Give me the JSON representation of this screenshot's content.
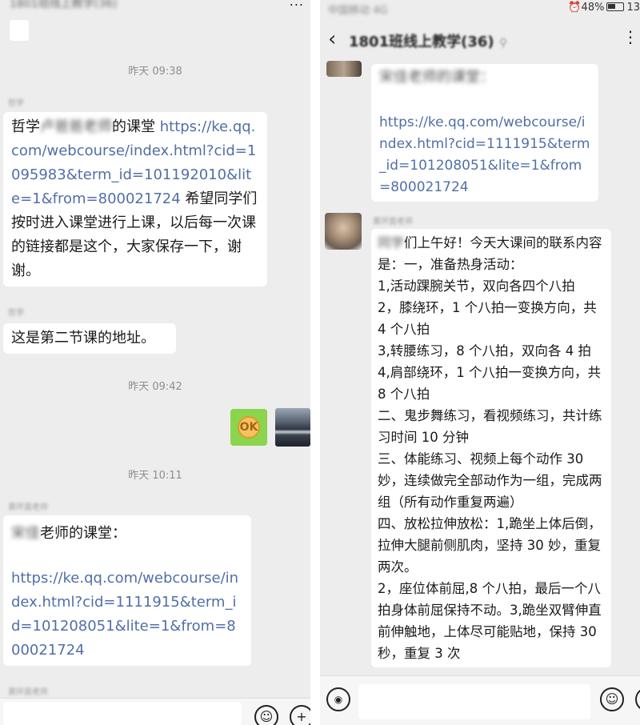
{
  "left": {
    "top_title": "1801班线上教学(36)",
    "top_dots": "...",
    "ts1": "昨天 09:38",
    "sender1": "哲学",
    "msg1_prefix": "哲学",
    "msg1_blur": "卢爸爸老师",
    "msg1_text": "的课堂 ",
    "msg1_link": "https://ke.qq.com/webcourse/index.html?cid=1095983&term_id=101192010&lite=1&from=800021724",
    "msg1_tail": " 希望同学们按时进入课堂进行上课，以后每一次课的链接都是这个，大家保存一下，谢谢。",
    "sender2": "哲学",
    "msg2": "这是第二节课的地址。",
    "ts2": "昨天 09:42",
    "ok_emoji": "OK",
    "ts3": "昨天 10:11",
    "sender3": "黄环茵老师",
    "msg3_blur": "宋佳",
    "msg3_text": "老师的课堂：",
    "msg3_link": "https://ke.qq.com/webcourse/index.html?cid=1111915&term_id=101208051&lite=1&from=800021724",
    "sender4": "黄环茵老师",
    "emoji_icon": "☺",
    "plus_icon": "+"
  },
  "right": {
    "status_left": "中国移动 4G",
    "alarm_icon": "⏰",
    "battery_pct": "48%",
    "time": "13",
    "back_arrow": "‹",
    "chat_title": "1801班线上教学(36)",
    "chat_title_suffix": "⚲",
    "more_icon": "⋮",
    "msg1_blur": "宋佳",
    "msg1_text": "老师的课堂：",
    "msg1_link": "https://ke.qq.com/webcourse/index.html?cid=1111915&term_id=101208051&lite=1&from=800021724",
    "sender2": "黄环茵老师",
    "msg2_blur": "同学",
    "msg2_lines": [
      "们上午好！今天大课间的联系内容是：一，准备热身活动：",
      "1,活动踝腕关节，双向各四个八拍",
      "2，膝绕环，1 个八拍一变换方向，共 4 个八拍",
      "3,转腰练习，8 个八拍，双向各 4 拍",
      "4,肩部绕环，1 个八拍一变换方向，共 8 个八拍",
      "二、鬼步舞练习，看视频练习，共计练习时间 10 分钟",
      "三、体能练习、视频上每个动作 30 妙，连续做完全部动作为一组，完成两组（所有动作重复两遍）",
      "四、放松拉伸放松：1,跪坐上体后倒，拉伸大腿前侧肌肉，坚持 30 妙，重复两次。",
      "2，座位体前屈,8 个八拍，最后一个八拍身体前屈保持不动。3,跪坐双臂伸直前伸触地，上体尽可能贴地，保持 30 秒，重复 3 次"
    ],
    "voice_icon": "◉",
    "emoji_icon": "☺",
    "plus_icon": "+"
  }
}
